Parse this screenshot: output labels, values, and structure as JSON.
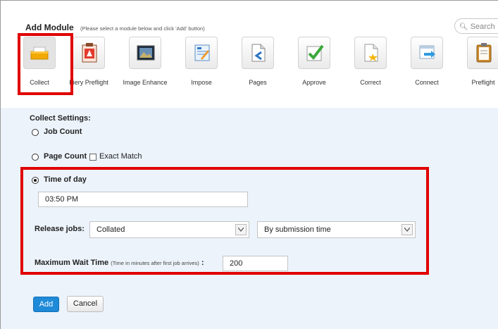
{
  "header": {
    "title": "Add Module",
    "hint": "(Please select a module below and click 'Add' button)",
    "search_placeholder": "Search"
  },
  "modules": [
    {
      "label": "Collect",
      "icon": "collect-tray-icon",
      "selected": true
    },
    {
      "label": "Fiery Preflight",
      "icon": "fiery-preflight-icon",
      "selected": false
    },
    {
      "label": "Image Enhance",
      "icon": "image-enhance-icon",
      "selected": false
    },
    {
      "label": "Impose",
      "icon": "impose-icon",
      "selected": false
    },
    {
      "label": "Pages",
      "icon": "pages-icon",
      "selected": false
    },
    {
      "label": "Approve",
      "icon": "approve-checkmark-icon",
      "selected": false
    },
    {
      "label": "Correct",
      "icon": "correct-icon",
      "selected": false
    },
    {
      "label": "Connect",
      "icon": "connect-icon",
      "selected": false
    },
    {
      "label": "Preflight",
      "icon": "preflight-clipboard-icon",
      "selected": false
    }
  ],
  "settings": {
    "title": "Collect Settings:",
    "job_count": {
      "label": "Job Count",
      "selected": false
    },
    "page_count": {
      "label": "Page Count",
      "selected": false
    },
    "exact_match": {
      "label": "Exact Match",
      "checked": false
    },
    "time_of_day": {
      "label": "Time of day",
      "selected": true,
      "value": "03:50 PM"
    },
    "release_jobs": {
      "label": "Release jobs:",
      "collation_value": "Collated",
      "order_value": "By submission time"
    },
    "max_wait": {
      "label": "Maximum Wait Time",
      "note": "(Time in minutes after first job arrives)",
      "colon": ":",
      "value": "200"
    }
  },
  "actions": {
    "add_label": "Add",
    "cancel_label": "Cancel"
  },
  "colors": {
    "accent": "#1e8ad8",
    "highlight": "#e00000",
    "settings_bg": "#ecf3fb"
  }
}
